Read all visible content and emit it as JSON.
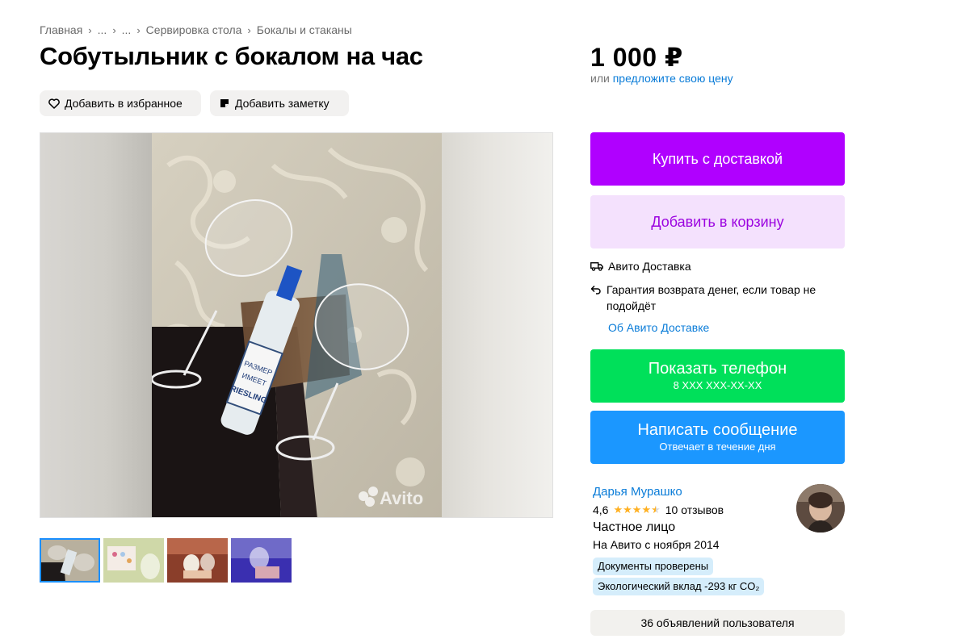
{
  "breadcrumb": {
    "items": [
      "Главная",
      "...",
      "...",
      "Сервировка стола",
      "Бокалы и стаканы"
    ],
    "separator": "›"
  },
  "item": {
    "title": "Собутыльник с бокалом на час",
    "price": "1 000 ₽",
    "price_or": "или",
    "price_offer_link": "предложите свою цену"
  },
  "actions": {
    "favorite_label": "Добавить в избранное",
    "favorite_icon": "heart-icon",
    "note_label": "Добавить заметку",
    "note_icon": "note-icon"
  },
  "gallery": {
    "watermark": "Avito",
    "thumbnail_count": 4,
    "active_thumbnail": 1
  },
  "buy": {
    "buy_label": "Купить с доставкой",
    "cart_label": "Добавить в корзину"
  },
  "delivery": {
    "service_label": "Авито Доставка",
    "service_icon": "truck-icon",
    "guarantee_label": "Гарантия возврата денег, если товар не подойдёт",
    "guarantee_icon": "return-arrow-icon",
    "about_link": "Об Авито Доставке"
  },
  "contact": {
    "phone_label": "Показать телефон",
    "phone_masked": "8 XXX XXX-XX-XX",
    "message_label": "Написать сообщение",
    "message_sub": "Отвечает в течение дня"
  },
  "seller": {
    "name": "Дарья Мурашко",
    "rating": "4,6",
    "rating_value": 4.6,
    "reviews": "10 отзывов",
    "type": "Частное лицо",
    "since": "На Авито с ноября 2014",
    "badge_docs": "Документы проверены",
    "badge_eco": "Экологический вклад -293 кг CO₂",
    "all_ads": "36 объявлений пользователя"
  },
  "colors": {
    "buy_button": "#b000ff",
    "cart_button": "#f4e1fd",
    "phone_button": "#00e05a",
    "message_button": "#1b97ff",
    "link": "#0a7cd8",
    "star": "#ffb021"
  }
}
